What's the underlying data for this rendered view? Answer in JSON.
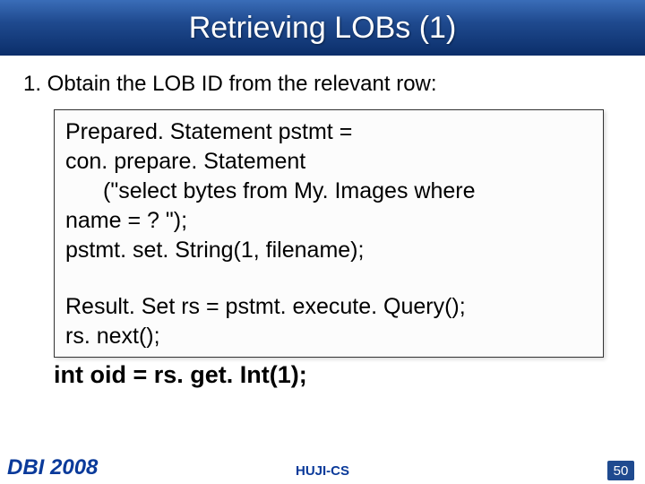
{
  "title": "Retrieving LOBs (1)",
  "step1_label": "1.  Obtain the LOB ID from the relevant row:",
  "code": {
    "l1": "Prepared. Statement pstmt =",
    "l2": "con. prepare. Statement",
    "l3": "(\"select bytes from My. Images where",
    "l4": "name = ? \");",
    "l5": "pstmt. set. String(1, filename);",
    "l6": "Result. Set rs = pstmt. execute. Query();",
    "l7": "rs. next();"
  },
  "last_line": "int oid = rs. get. Int(1);",
  "footer": {
    "left": "DBI 2008",
    "center": "HUJI-CS",
    "page": "50"
  }
}
